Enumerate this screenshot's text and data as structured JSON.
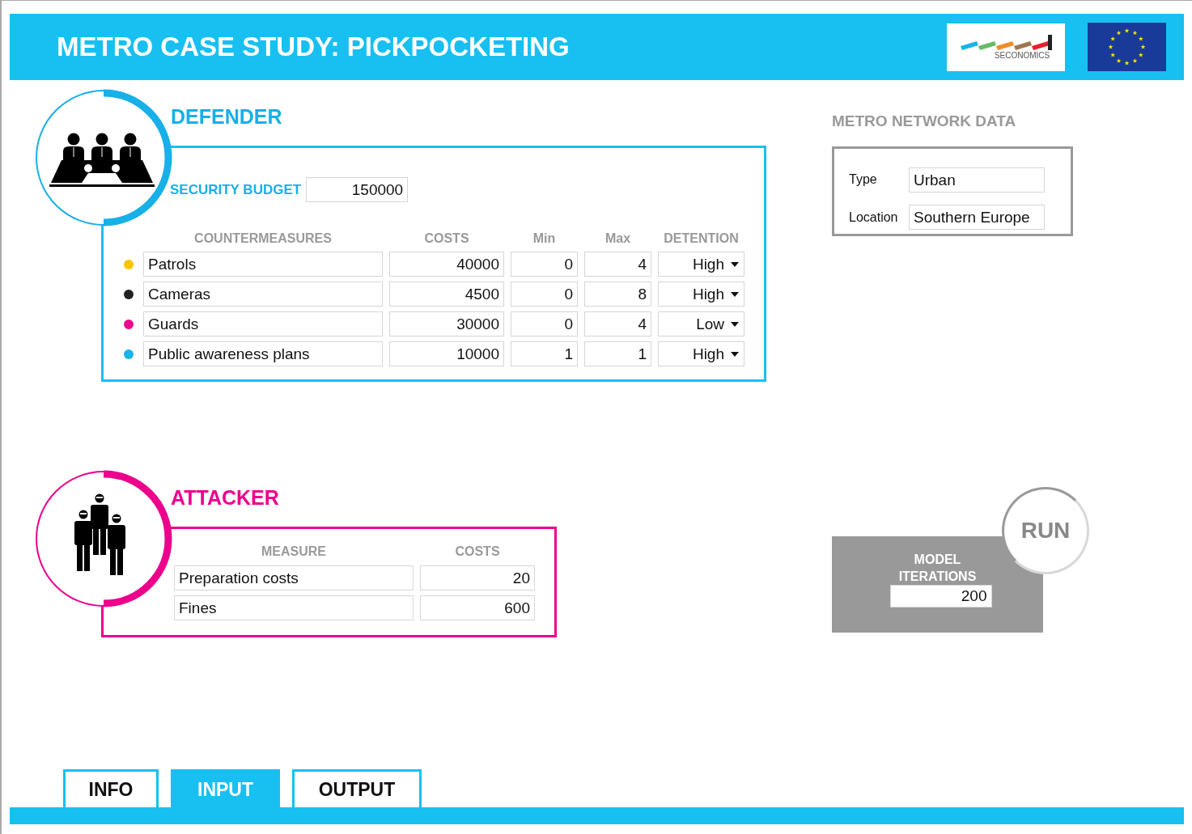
{
  "header": {
    "title": "METRO CASE STUDY: PICKPOCKETING",
    "logo_text": "SECONOMICS"
  },
  "defender": {
    "title": "DEFENDER",
    "budget_label": "SECURITY BUDGET",
    "budget": "150000",
    "columns": [
      "COUNTERMEASURES",
      "COSTS",
      "Min",
      "Max",
      "DETENTION"
    ],
    "rows": [
      {
        "color": "#f7c600",
        "name": "Patrols",
        "cost": "40000",
        "min": "0",
        "max": "4",
        "detention": "High"
      },
      {
        "color": "#222222",
        "name": "Cameras",
        "cost": "4500",
        "min": "0",
        "max": "8",
        "detention": "High"
      },
      {
        "color": "#ec0a8c",
        "name": "Guards",
        "cost": "30000",
        "min": "0",
        "max": "4",
        "detention": "Low"
      },
      {
        "color": "#1ab3ea",
        "name": "Public awareness plans",
        "cost": "10000",
        "min": "1",
        "max": "1",
        "detention": "High"
      }
    ]
  },
  "network": {
    "title": "METRO NETWORK DATA",
    "fields": [
      {
        "label": "Type",
        "value": "Urban"
      },
      {
        "label": "Location",
        "value": "Southern Europe"
      }
    ]
  },
  "attacker": {
    "title": "ATTACKER",
    "columns": [
      "MEASURE",
      "COSTS"
    ],
    "rows": [
      {
        "name": "Preparation costs",
        "cost": "20"
      },
      {
        "name": "Fines",
        "cost": "600"
      }
    ]
  },
  "run": {
    "button": "RUN",
    "label": "MODEL ITERATIONS",
    "iterations": "200"
  },
  "tabs": [
    {
      "label": "INFO",
      "selected": false
    },
    {
      "label": "INPUT",
      "selected": true
    },
    {
      "label": "OUTPUT",
      "selected": false
    }
  ]
}
